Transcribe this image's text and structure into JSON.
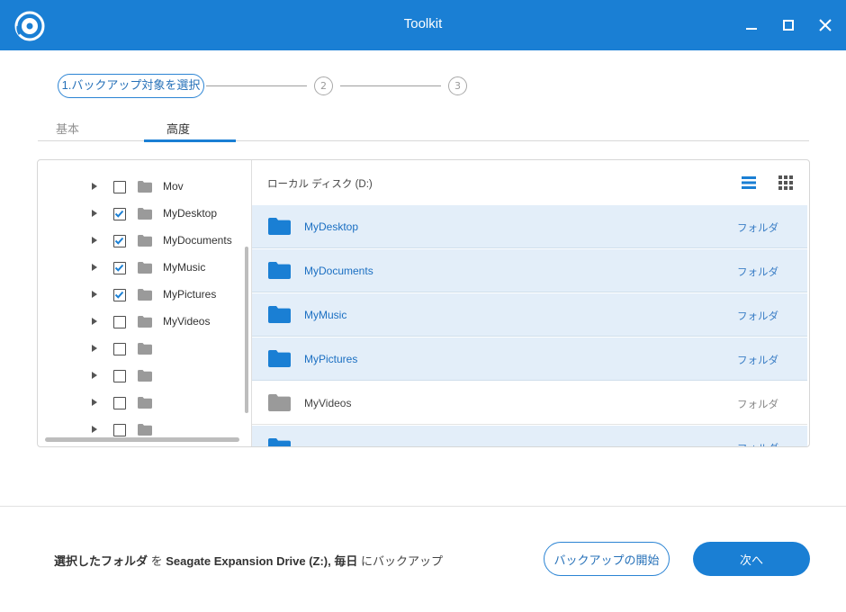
{
  "window": {
    "title": "Toolkit",
    "accent_color": "#1a7fd4",
    "controls": [
      "minimize-icon",
      "maximize-icon",
      "close-icon"
    ]
  },
  "stepper": {
    "step1_label": "1.バックアップ対象を選択",
    "step2_number": "2",
    "step3_number": "3"
  },
  "tabs": [
    {
      "label": "基本",
      "active": false
    },
    {
      "label": "高度",
      "active": true
    }
  ],
  "tree": {
    "items": [
      {
        "label": "Mov",
        "checked": false
      },
      {
        "label": "MyDesktop",
        "checked": true
      },
      {
        "label": "MyDocuments",
        "checked": true
      },
      {
        "label": "MyMusic",
        "checked": true
      },
      {
        "label": "MyPictures",
        "checked": true
      },
      {
        "label": "MyVideos",
        "checked": false
      },
      {
        "label": "",
        "checked": false
      },
      {
        "label": "",
        "checked": false
      },
      {
        "label": "",
        "checked": false
      },
      {
        "label": "",
        "checked": false
      }
    ]
  },
  "files": {
    "path": "ローカル ディスク (D:)",
    "rows": [
      {
        "name": "MyDesktop",
        "type": "フォルダ",
        "selected": true
      },
      {
        "name": "MyDocuments",
        "type": "フォルダ",
        "selected": true
      },
      {
        "name": "MyMusic",
        "type": "フォルダ",
        "selected": true
      },
      {
        "name": "MyPictures",
        "type": "フォルダ",
        "selected": true
      },
      {
        "name": "MyVideos",
        "type": "フォルダ",
        "selected": false
      },
      {
        "name": "",
        "type": "フォルダ",
        "selected": true
      }
    ]
  },
  "footer": {
    "summary_part1": "選択したフォルダ",
    "summary_part2": " を ",
    "summary_part3": "Seagate Expansion Drive (Z:), 毎日",
    "summary_part4": " にバックアップ",
    "start_label": "バックアップの開始",
    "next_label": "次へ"
  }
}
